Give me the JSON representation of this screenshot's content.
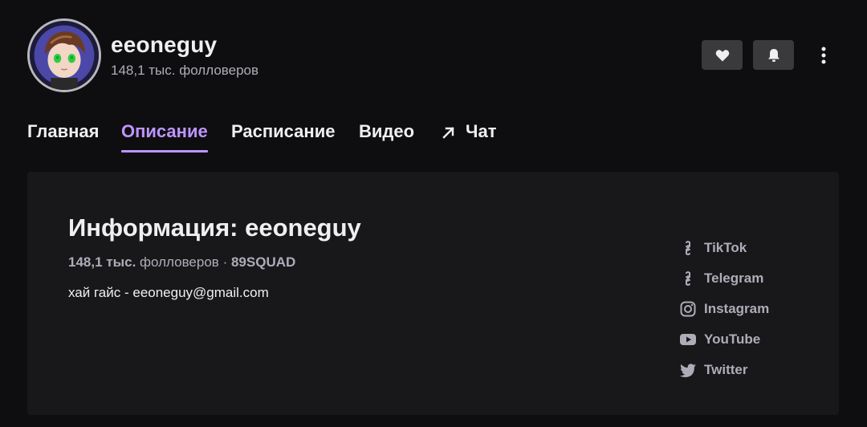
{
  "channel": {
    "name": "eeoneguy",
    "followers": "148,1 тыс. фолловеров"
  },
  "nav": {
    "tabs": [
      {
        "label": "Главная"
      },
      {
        "label": "Описание",
        "active": true
      },
      {
        "label": "Расписание"
      },
      {
        "label": "Видео"
      },
      {
        "label": "Чат",
        "icon": "external-arrow-icon"
      }
    ]
  },
  "about": {
    "title": "Информация: eeoneguy",
    "followers_count": "148,1 тыс.",
    "followers_label": "фолловеров",
    "separator": "·",
    "team": "89SQUAD",
    "description": "хай гайс - eeoneguy@gmail.com"
  },
  "social_links": [
    {
      "label": "TikTok",
      "icon": "link-icon"
    },
    {
      "label": "Telegram",
      "icon": "link-icon"
    },
    {
      "label": "Instagram",
      "icon": "instagram-icon"
    },
    {
      "label": "YouTube",
      "icon": "youtube-icon"
    },
    {
      "label": "Twitter",
      "icon": "twitter-icon"
    }
  ],
  "colors": {
    "background": "#0e0e10",
    "panel": "#18181b",
    "accent": "#bf94ff",
    "button": "#3a3a3d",
    "text": "#efeff1",
    "muted": "#adadb8"
  }
}
